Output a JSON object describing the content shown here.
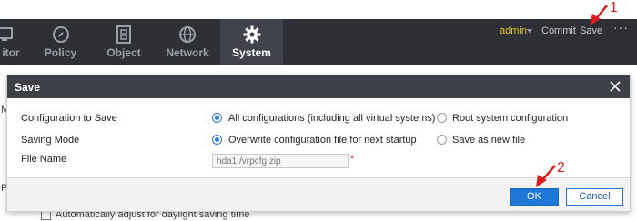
{
  "nav": {
    "tabs": [
      {
        "label": "itor",
        "icon": "monitor-icon"
      },
      {
        "label": "Policy",
        "icon": "compass-icon"
      },
      {
        "label": "Object",
        "icon": "object-icon"
      },
      {
        "label": "Network",
        "icon": "globe-icon"
      },
      {
        "label": "System",
        "icon": "gear-icon"
      }
    ],
    "active_tab": "System",
    "user": "admin",
    "commit_label": "Commit",
    "save_label": "Save",
    "more_label": "···"
  },
  "background": {
    "letter_m": "M",
    "letter_p": "P",
    "checkbox_label": "Automatically adjust for daylight saving time"
  },
  "dialog": {
    "title": "Save",
    "rows": [
      {
        "label": "Configuration to Save",
        "option1": "All configurations (including all virtual systems)",
        "option2": "Root system configuration",
        "selected": "option1"
      },
      {
        "label": "Saving Mode",
        "option1": "Overwrite configuration file for next startup",
        "option2": "Save as new file",
        "selected": "option1"
      }
    ],
    "file_name": {
      "label": "File Name",
      "value": "hda1:/vrpcfg.zip",
      "required_mark": "*"
    },
    "ok_label": "OK",
    "cancel_label": "Cancel"
  },
  "annotations": {
    "step1": "1",
    "step2": "2",
    "color": "#d81e1e"
  },
  "colors": {
    "navbar": "#2e3035",
    "active_tab": "#40434b",
    "user": "#e2c21a",
    "primary": "#1f78d8"
  }
}
